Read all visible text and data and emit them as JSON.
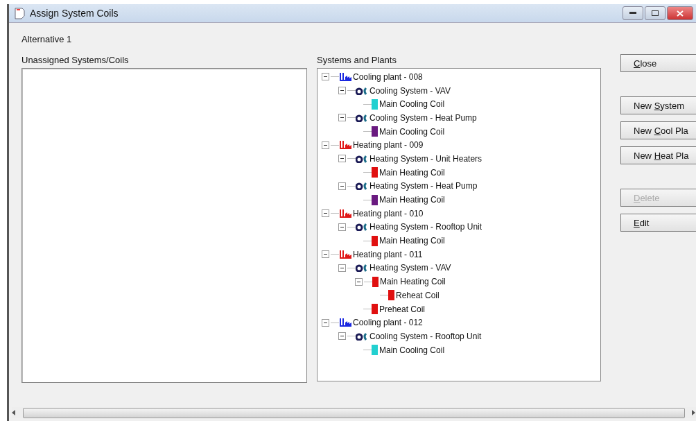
{
  "window": {
    "title": "Assign System Coils"
  },
  "alternative": "Alternative 1",
  "unassigned": {
    "label": "Unassigned Systems/Coils"
  },
  "systems": {
    "label": "Systems and Plants",
    "tree": [
      {
        "kind": "cooling-plant",
        "label": "Cooling plant - 008",
        "expanded": true,
        "children": [
          {
            "kind": "system",
            "label": "Cooling System - VAV",
            "expanded": true,
            "children": [
              {
                "kind": "coil",
                "label": "Main Cooling Coil",
                "color": "#22d0d0"
              }
            ]
          },
          {
            "kind": "system",
            "label": "Cooling System - Heat Pump",
            "expanded": true,
            "children": [
              {
                "kind": "coil",
                "label": "Main Cooling Coil",
                "color": "#6a1a80"
              }
            ]
          }
        ]
      },
      {
        "kind": "heating-plant",
        "label": "Heating plant - 009",
        "expanded": true,
        "children": [
          {
            "kind": "system",
            "label": "Heating System - Unit Heaters",
            "expanded": true,
            "children": [
              {
                "kind": "coil",
                "label": "Main Heating Coil",
                "color": "#e01010"
              }
            ]
          },
          {
            "kind": "system",
            "label": "Heating System - Heat Pump",
            "expanded": true,
            "children": [
              {
                "kind": "coil",
                "label": "Main Heating Coil",
                "color": "#6a1a80"
              }
            ]
          }
        ]
      },
      {
        "kind": "heating-plant",
        "label": "Heating plant - 010",
        "expanded": true,
        "children": [
          {
            "kind": "system",
            "label": "Heating System - Rooftop Unit",
            "expanded": true,
            "children": [
              {
                "kind": "coil",
                "label": "Main Heating Coil",
                "color": "#e01010"
              }
            ]
          }
        ]
      },
      {
        "kind": "heating-plant",
        "label": "Heating plant - 011",
        "expanded": true,
        "children": [
          {
            "kind": "system",
            "label": "Heating System - VAV",
            "expanded": true,
            "children": [
              {
                "kind": "coil",
                "label": "Main Heating Coil",
                "color": "#e01010",
                "expanded": true,
                "children": [
                  {
                    "kind": "coil",
                    "label": "Reheat Coil",
                    "color": "#e01010"
                  }
                ]
              },
              {
                "kind": "coil",
                "label": "Preheat Coil",
                "color": "#e01010"
              }
            ]
          }
        ]
      },
      {
        "kind": "cooling-plant",
        "label": "Cooling plant - 012",
        "expanded": true,
        "children": [
          {
            "kind": "system",
            "label": "Cooling System - Rooftop Unit",
            "expanded": true,
            "children": [
              {
                "kind": "coil",
                "label": "Main Cooling Coil",
                "color": "#22d0d0"
              }
            ]
          }
        ]
      }
    ]
  },
  "button_groups": [
    [
      {
        "mnemonic": "C",
        "after": "lose",
        "disabled": false
      }
    ],
    [
      {
        "before": "New ",
        "mnemonic": "S",
        "after": "ystem",
        "disabled": false
      },
      {
        "before": "New ",
        "mnemonic": "C",
        "after": "ool Pla",
        "disabled": false
      },
      {
        "before": "New ",
        "mnemonic": "H",
        "after": "eat Pla",
        "disabled": false
      }
    ],
    [
      {
        "mnemonic": "D",
        "after": "elete",
        "disabled": true
      },
      {
        "mnemonic": "E",
        "after": "dit",
        "disabled": false
      }
    ]
  ]
}
